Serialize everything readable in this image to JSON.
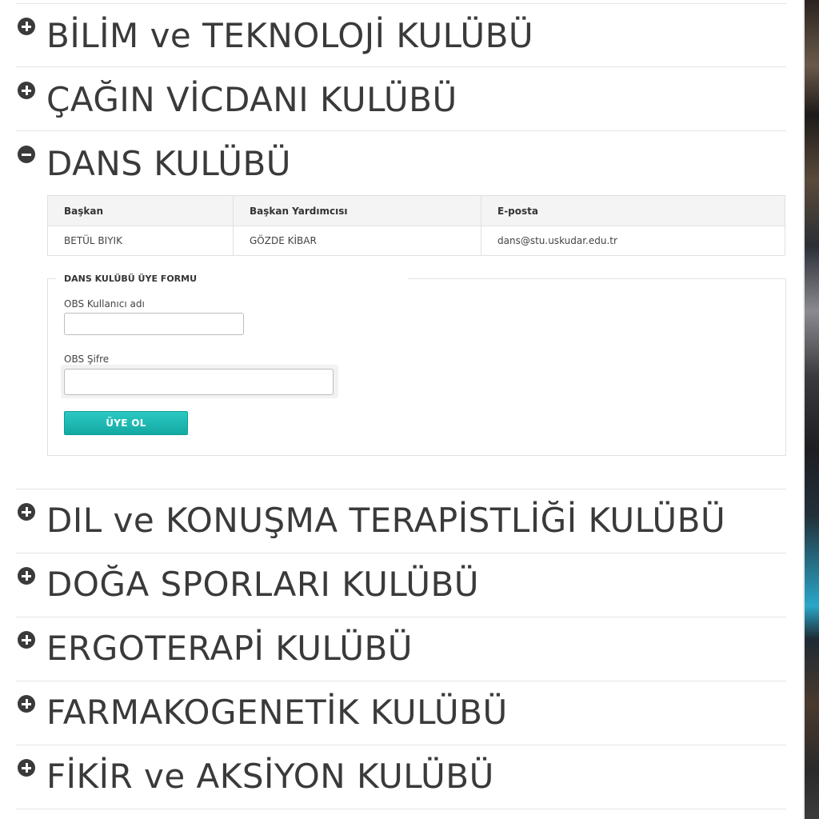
{
  "clubs_before": [
    {
      "title": "BİLİM ve TEKNOLOJİ KULÜBÜ",
      "state": "collapsed"
    },
    {
      "title": "ÇAĞIN VİCDANI KULÜBÜ",
      "state": "collapsed"
    }
  ],
  "open_club": {
    "title": "DANS KULÜBÜ",
    "state": "expanded",
    "table": {
      "headers": [
        "Başkan",
        "Başkan Yardımcısı",
        "E-posta"
      ],
      "rows": [
        [
          "BETÜL BIYIK",
          "GÖZDE KİBAR",
          "dans@stu.uskudar.edu.tr"
        ]
      ]
    },
    "form": {
      "legend": "DANS KULÜBÜ ÜYE FORMU",
      "username_label": "OBS Kullanıcı adı",
      "username_value": "",
      "password_label": "OBS Şifre",
      "password_value": "",
      "submit_label": "ÜYE OL",
      "submit_color": "#1bb5af"
    }
  },
  "clubs_after": [
    {
      "title": "DIL ve KONUŞMA TERAPİSTLİĞİ KULÜBÜ",
      "state": "collapsed"
    },
    {
      "title": "DOĞA SPORLARI KULÜBÜ",
      "state": "collapsed"
    },
    {
      "title": "ERGOTERAPİ KULÜBÜ",
      "state": "collapsed"
    },
    {
      "title": "FARMAKOGENETİK KULÜBÜ",
      "state": "collapsed"
    },
    {
      "title": "FİKİR ve AKSİYON KULÜBÜ",
      "state": "collapsed"
    }
  ],
  "icons": {
    "collapsed": "plus-circle-icon",
    "expanded": "minus-circle-icon"
  }
}
